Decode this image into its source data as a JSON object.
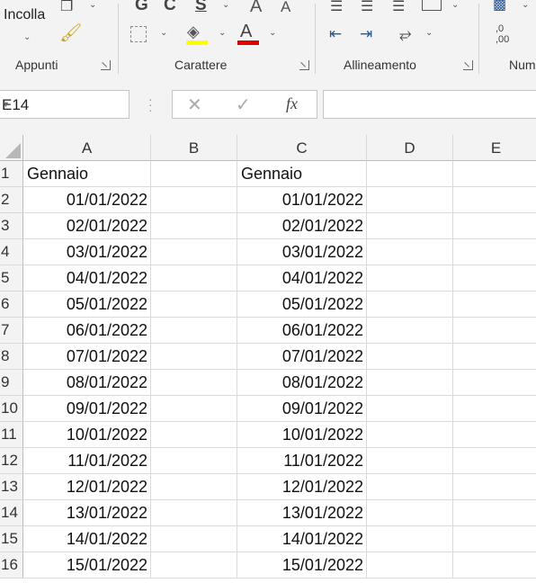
{
  "ribbon": {
    "groups": [
      {
        "label": "Appunti"
      },
      {
        "label": "Carattere"
      },
      {
        "label": "Allineamento"
      },
      {
        "label": "Num"
      }
    ],
    "paste_label": "Incolla",
    "bold_glyph": "G",
    "italic_glyph": "C",
    "underline_glyph": "S",
    "grow_font_glyph": "A",
    "shrink_font_glyph": "A",
    "font_color_glyph": "A",
    "decimal_increase": ",0\n,00",
    "colors": {
      "highlight": "#ffff00",
      "font_color": "#e00000"
    }
  },
  "formula_bar": {
    "name_box": "E14",
    "fx_label": "fx",
    "formula": ""
  },
  "sheet": {
    "columns": [
      "A",
      "B",
      "C",
      "D",
      "E"
    ],
    "rows": [
      {
        "n": "1",
        "a": "Gennaio",
        "c": "Gennaio"
      },
      {
        "n": "2",
        "a": "01/01/2022",
        "c": "01/01/2022"
      },
      {
        "n": "3",
        "a": "02/01/2022",
        "c": "02/01/2022"
      },
      {
        "n": "4",
        "a": "03/01/2022",
        "c": "03/01/2022"
      },
      {
        "n": "5",
        "a": "04/01/2022",
        "c": "04/01/2022"
      },
      {
        "n": "6",
        "a": "05/01/2022",
        "c": "05/01/2022"
      },
      {
        "n": "7",
        "a": "06/01/2022",
        "c": "06/01/2022"
      },
      {
        "n": "8",
        "a": "07/01/2022",
        "c": "07/01/2022"
      },
      {
        "n": "9",
        "a": "08/01/2022",
        "c": "08/01/2022"
      },
      {
        "n": "10",
        "a": "09/01/2022",
        "c": "09/01/2022"
      },
      {
        "n": "11",
        "a": "10/01/2022",
        "c": "10/01/2022"
      },
      {
        "n": "12",
        "a": "11/01/2022",
        "c": "11/01/2022"
      },
      {
        "n": "13",
        "a": "12/01/2022",
        "c": "12/01/2022"
      },
      {
        "n": "14",
        "a": "13/01/2022",
        "c": "13/01/2022"
      },
      {
        "n": "15",
        "a": "14/01/2022",
        "c": "14/01/2022"
      },
      {
        "n": "16",
        "a": "15/01/2022",
        "c": "15/01/2022"
      }
    ]
  }
}
